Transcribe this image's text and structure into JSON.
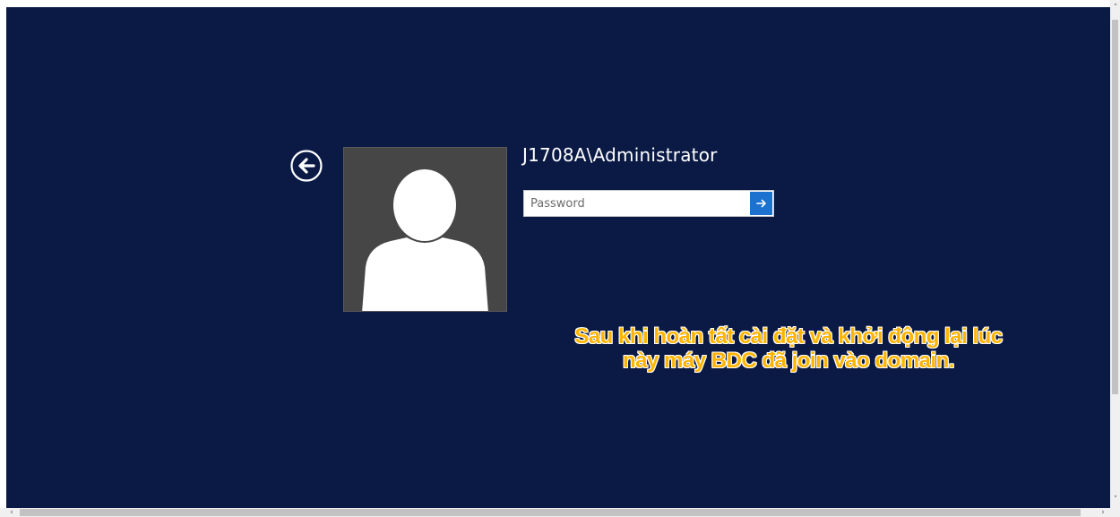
{
  "login": {
    "username": "J1708A\\Administrator",
    "password_placeholder": "Password",
    "password_value": "",
    "back_icon": "arrow-left-circle-icon",
    "submit_icon": "arrow-right-icon",
    "avatar_icon": "user-silhouette-icon"
  },
  "annotation": {
    "line1": "Sau khi hoàn tất cài đặt và khởi động lại lúc",
    "line2": "này máy BDC đã join vào domain."
  },
  "scrollbars": {
    "up_arrow": "˄",
    "down_arrow": "˅",
    "left_arrow": "‹",
    "right_arrow": "›"
  },
  "colors": {
    "background": "#0b1a45",
    "accent": "#1d72d0",
    "avatar_bg": "#464646",
    "caption": "#ffb400"
  }
}
